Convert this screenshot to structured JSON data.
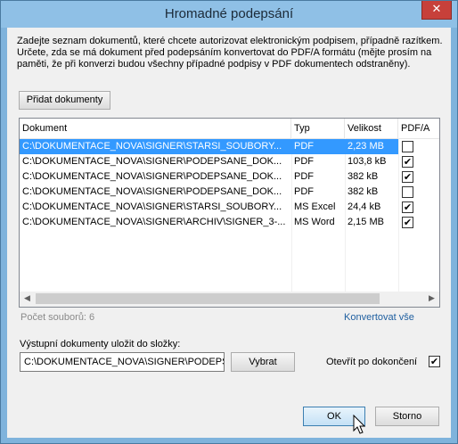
{
  "window": {
    "title": "Hromadné podepsání",
    "close_glyph": "✕"
  },
  "description": {
    "lines": [
      "Zadejte seznam dokumentů, které chcete autorizovat elektronickým podpisem, případně razítkem.",
      "Určete, zda se má dokument před podepsáním konvertovat do PDF/A formátu (mějte prosím na",
      "paměti, že při konverzi budou všechny případné podpisy v PDF dokumentech odstraněny)."
    ]
  },
  "add_button": {
    "label": "Přidat dokumenty"
  },
  "table": {
    "columns": [
      "Dokument",
      "Typ",
      "Velikost",
      "PDF/A"
    ],
    "rows": [
      {
        "path": "C:\\DOKUMENTACE_NOVA\\SIGNER\\STARSI_SOUBORY...",
        "type": "PDF",
        "size": "2,23 MB",
        "pdfa": false,
        "selected": true
      },
      {
        "path": "C:\\DOKUMENTACE_NOVA\\SIGNER\\PODEPSANE_DOK...",
        "type": "PDF",
        "size": "103,8 kB",
        "pdfa": true,
        "selected": false
      },
      {
        "path": "C:\\DOKUMENTACE_NOVA\\SIGNER\\PODEPSANE_DOK...",
        "type": "PDF",
        "size": "382 kB",
        "pdfa": true,
        "selected": false
      },
      {
        "path": "C:\\DOKUMENTACE_NOVA\\SIGNER\\PODEPSANE_DOK...",
        "type": "PDF",
        "size": "382 kB",
        "pdfa": false,
        "selected": false
      },
      {
        "path": "C:\\DOKUMENTACE_NOVA\\SIGNER\\STARSI_SOUBORY...",
        "type": "MS Excel",
        "size": "24,4 kB",
        "pdfa": true,
        "selected": false
      },
      {
        "path": "C:\\DOKUMENTACE_NOVA\\SIGNER\\ARCHIV\\SIGNER_3-...",
        "type": "MS Word",
        "size": "2,15 MB",
        "pdfa": true,
        "selected": false
      }
    ],
    "check_glyph": "✔",
    "scroll_left_glyph": "◀",
    "scroll_right_glyph": "▶"
  },
  "file_count": "Počet souborů: 6",
  "convert_all_link": "Konvertovat vše",
  "output": {
    "label": "Výstupní dokumenty uložit do složky:",
    "path_value": "C:\\DOKUMENTACE_NOVA\\SIGNER\\PODEPSANE",
    "browse_label": "Vybrat",
    "open_after_label": "Otevřít po dokončení",
    "open_after_checked": true
  },
  "footer": {
    "ok_label": "OK",
    "cancel_label": "Storno"
  },
  "colors": {
    "selection": "#3399ff",
    "link": "#1f5fa0",
    "title_bar": "#8fc0e6",
    "close_button": "#c7403a"
  }
}
